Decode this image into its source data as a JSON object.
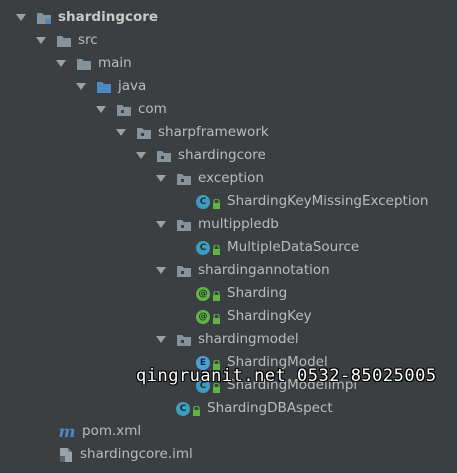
{
  "tree": {
    "root": {
      "label": "shardingcore",
      "icon": "module-folder-icon",
      "expanded": true
    },
    "src": {
      "label": "src",
      "icon": "folder-icon",
      "expanded": true
    },
    "main": {
      "label": "main",
      "icon": "folder-icon",
      "expanded": true
    },
    "java": {
      "label": "java",
      "icon": "source-folder-icon",
      "expanded": true
    },
    "com": {
      "label": "com",
      "icon": "package-icon",
      "expanded": true
    },
    "sharpframework": {
      "label": "sharpframework",
      "icon": "package-icon",
      "expanded": true
    },
    "shardingcore_pkg": {
      "label": "shardingcore",
      "icon": "package-icon",
      "expanded": true
    },
    "exception": {
      "label": "exception",
      "icon": "package-icon",
      "expanded": true
    },
    "sharding_key_missing_exception": {
      "label": "ShardingKeyMissingException",
      "icon": "class-icon",
      "badge": "C"
    },
    "multippledb": {
      "label": "multippledb",
      "icon": "package-icon",
      "expanded": true
    },
    "multiple_data_source": {
      "label": "MultipleDataSource",
      "icon": "class-icon",
      "badge": "C"
    },
    "shardingannotation": {
      "label": "shardingannotation",
      "icon": "package-icon",
      "expanded": true
    },
    "sharding": {
      "label": "Sharding",
      "icon": "annotation-icon",
      "badge": "@"
    },
    "sharding_key": {
      "label": "ShardingKey",
      "icon": "annotation-icon",
      "badge": "@"
    },
    "shardingmodel": {
      "label": "shardingmodel",
      "icon": "package-icon",
      "expanded": true
    },
    "sharding_model": {
      "label": "ShardingModel",
      "icon": "enum-icon",
      "badge": "E"
    },
    "sharding_model_impl": {
      "label": "ShardingModelImpl",
      "icon": "class-icon",
      "badge": "C"
    },
    "sharding_db_aspect": {
      "label": "ShardingDBAspect",
      "icon": "class-icon",
      "badge": "C"
    },
    "pom": {
      "label": "pom.xml",
      "icon": "maven-icon",
      "badge": "m"
    },
    "iml": {
      "label": "shardingcore.iml",
      "icon": "file-icon"
    }
  },
  "watermark": {
    "text": "qingruanit.net 0532-85025005"
  },
  "colors": {
    "background": "#3c3f41",
    "text": "#bbbbbb",
    "folder": "#87939a",
    "source_folder": "#4a8bc4",
    "class_badge": "#3d9dc1",
    "annotation_badge": "#62b543",
    "enum_badge": "#4a9fd6",
    "lock": "#62b543"
  }
}
